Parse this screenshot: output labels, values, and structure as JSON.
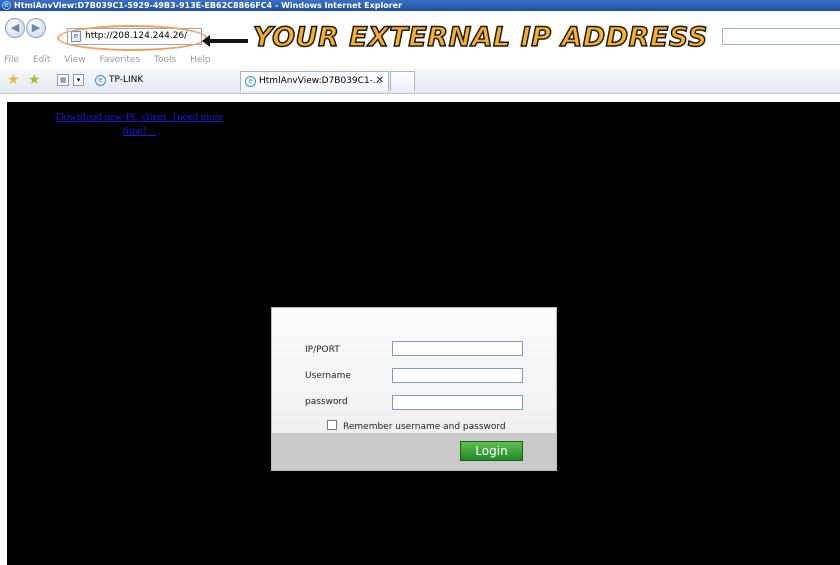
{
  "window": {
    "title": "HtmlAnvView:D7B039C1-5929-49B3-913E-EB62C8866FC4 - Windows Internet Explorer"
  },
  "address_bar": {
    "url": "http://208.124.244.26/"
  },
  "annotation": {
    "text": "YOUR EXTERNAL IP ADDRESS",
    "color": "#fab024"
  },
  "menu": [
    "File",
    "Edit",
    "View",
    "Favorites",
    "Tools",
    "Help"
  ],
  "tabs": [
    {
      "label": "TP-LINK"
    },
    {
      "label": "HtmlAnvView:D7B039C1-..."
    }
  ],
  "page": {
    "download_link": "Download new PC client（need more time）.",
    "login": {
      "ip_port_label": "IP/PORT",
      "username_label": "Username",
      "password_label": "password",
      "ip_port_value": "",
      "username_value": "",
      "password_value": "",
      "remember_label": "Remember username and password",
      "login_button": "Login"
    }
  },
  "icons": [
    "ie-icon",
    "back-icon",
    "forward-icon",
    "page-icon",
    "favorites-star-icon",
    "add-favorite-icon",
    "quick-tabs-icon",
    "dropdown-icon",
    "tab-close-icon"
  ],
  "colors": {
    "title_bar": "#1f4f9e",
    "login_button": "#1f8a28",
    "page_background": "#000000",
    "link": "#1a1ad6"
  }
}
